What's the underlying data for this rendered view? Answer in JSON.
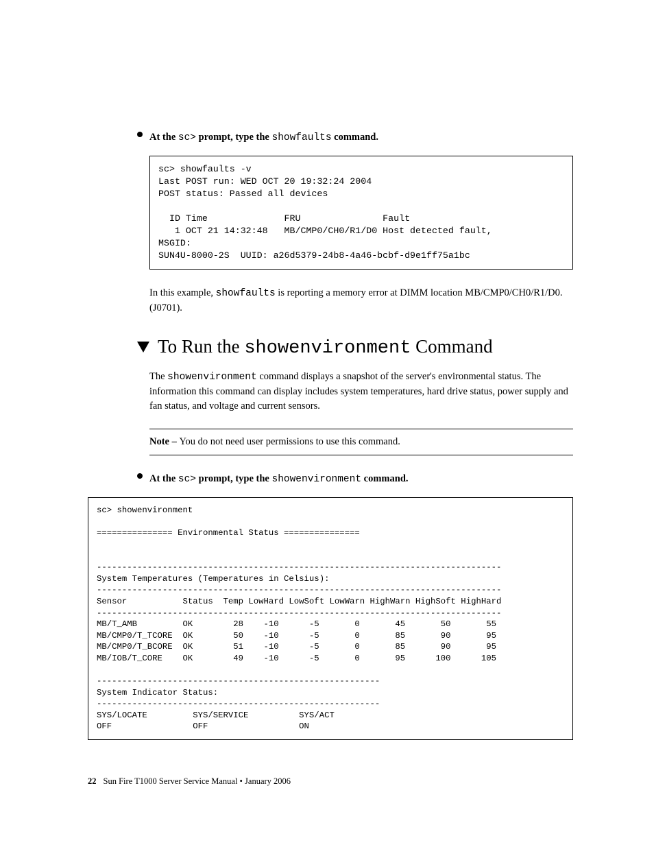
{
  "step1": {
    "prefix": "At the ",
    "prompt_text": "sc>",
    "mid": " prompt, type the ",
    "cmd": "showfaults",
    "suffix": " command."
  },
  "codebox1": "sc> showfaults -v\nLast POST run: WED OCT 20 19:32:24 2004\nPOST status: Passed all devices\n\n  ID Time              FRU               Fault\n   1 OCT 21 14:32:48   MB/CMP0/CH0/R1/D0 Host detected fault,\nMSGID:\nSUN4U-8000-2S  UUID: a26d5379-24b8-4a46-bcbf-d9e1ff75a1bc",
  "para1": {
    "prefix": "In this example, ",
    "cmd": "showfaults",
    "suffix": " is reporting a memory error at DIMM location MB/CMP0/CH0/R1/D0. (J0701)."
  },
  "heading": {
    "prefix": "To Run the ",
    "cmd": "showenvironment",
    "suffix": " Command"
  },
  "desc": {
    "prefix": "The ",
    "cmd": "showenvironment",
    "suffix": "  command displays a snapshot of the server's environmental status. The information this command can display includes system temperatures, hard drive status, power supply and fan status, and voltage and current sensors."
  },
  "note": {
    "label": "Note – ",
    "text": "You do not need user permissions to use this command."
  },
  "step2": {
    "prefix": "At the ",
    "prompt_text": "sc>",
    "mid": " prompt, type the ",
    "cmd": "showenvironment",
    "suffix": " command."
  },
  "codebox2": "sc> showenvironment\n\n=============== Environmental Status ===============\n\n\n--------------------------------------------------------------------------------\nSystem Temperatures (Temperatures in Celsius):\n--------------------------------------------------------------------------------\nSensor           Status  Temp LowHard LowSoft LowWarn HighWarn HighSoft HighHard\n--------------------------------------------------------------------------------\nMB/T_AMB         OK        28    -10      -5       0       45       50       55\nMB/CMP0/T_TCORE  OK        50    -10      -5       0       85       90       95\nMB/CMP0/T_BCORE  OK        51    -10      -5       0       85       90       95\nMB/IOB/T_CORE    OK        49    -10      -5       0       95      100      105\n\n--------------------------------------------------------\nSystem Indicator Status:\n--------------------------------------------------------\nSYS/LOCATE         SYS/SERVICE          SYS/ACT\nOFF                OFF                  ON",
  "footer": {
    "page": "22",
    "text": "Sun Fire T1000 Server Service Manual  •  January 2006"
  },
  "chart_data": {
    "type": "table",
    "title": "System Temperatures (Temperatures in Celsius)",
    "columns": [
      "Sensor",
      "Status",
      "Temp",
      "LowHard",
      "LowSoft",
      "LowWarn",
      "HighWarn",
      "HighSoft",
      "HighHard"
    ],
    "rows": [
      [
        "MB/T_AMB",
        "OK",
        28,
        -10,
        -5,
        0,
        45,
        50,
        55
      ],
      [
        "MB/CMP0/T_TCORE",
        "OK",
        50,
        -10,
        -5,
        0,
        85,
        90,
        95
      ],
      [
        "MB/CMP0/T_BCORE",
        "OK",
        51,
        -10,
        -5,
        0,
        85,
        90,
        95
      ],
      [
        "MB/IOB/T_CORE",
        "OK",
        49,
        -10,
        -5,
        0,
        95,
        100,
        105
      ]
    ],
    "indicators": {
      "SYS/LOCATE": "OFF",
      "SYS/SERVICE": "OFF",
      "SYS/ACT": "ON"
    }
  }
}
